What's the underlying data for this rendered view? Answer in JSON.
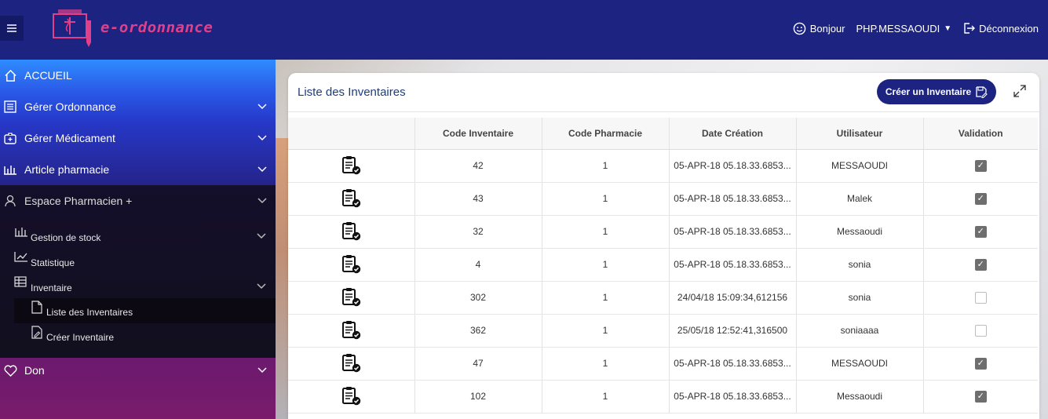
{
  "header": {
    "menu_icon": "hamburger-icon",
    "logo_text": "e-ordonnance",
    "greeting": "Bonjour",
    "user": "PHP.MESSAOUDI",
    "logout": "Déconnexion"
  },
  "sidebar": {
    "items": [
      {
        "label": "ACCUEIL",
        "icon": "home-icon"
      },
      {
        "label": "Gérer Ordonnance",
        "icon": "list-icon"
      },
      {
        "label": "Gérer Médicament",
        "icon": "medkit-icon"
      },
      {
        "label": "Article pharmacie",
        "icon": "bars-icon"
      },
      {
        "label": "Espace Pharmacien +",
        "icon": "user-icon"
      },
      {
        "label": "Don",
        "icon": "heart-icon"
      }
    ],
    "sub_items": [
      {
        "label": "Gestion de stock",
        "icon": "stock-icon"
      },
      {
        "label": "Statistique",
        "icon": "chart-icon"
      },
      {
        "label": "Inventaire",
        "icon": "table-icon"
      }
    ],
    "inventaire_items": [
      {
        "label": "Liste des Inventaires",
        "icon": "file-icon"
      },
      {
        "label": "Créer Inventaire",
        "icon": "file-edit-icon"
      }
    ]
  },
  "card": {
    "title": "Liste des Inventaires",
    "create_button": "Créer un Inventaire"
  },
  "table": {
    "columns": [
      "",
      "Code Inventaire",
      "Code Pharmacie",
      "Date Création",
      "Utilisateur",
      "Validation"
    ],
    "rows": [
      {
        "code": "42",
        "pharmacie": "1",
        "date": "05-APR-18 05.18.33.6853...",
        "user": "MESSAOUDI",
        "validated": true
      },
      {
        "code": "43",
        "pharmacie": "1",
        "date": "05-APR-18 05.18.33.6853...",
        "user": "Malek",
        "validated": true
      },
      {
        "code": "32",
        "pharmacie": "1",
        "date": "05-APR-18 05.18.33.6853...",
        "user": "Messaoudi",
        "validated": true
      },
      {
        "code": "4",
        "pharmacie": "1",
        "date": "05-APR-18 05.18.33.6853...",
        "user": "sonia",
        "validated": true
      },
      {
        "code": "302",
        "pharmacie": "1",
        "date": "24/04/18 15:09:34,612156",
        "user": "sonia",
        "validated": false
      },
      {
        "code": "362",
        "pharmacie": "1",
        "date": "25/05/18 12:52:41,316500",
        "user": "soniaaaa",
        "validated": false
      },
      {
        "code": "47",
        "pharmacie": "1",
        "date": "05-APR-18 05.18.33.6853...",
        "user": "MESSAOUDI",
        "validated": true
      },
      {
        "code": "102",
        "pharmacie": "1",
        "date": "05-APR-18 05.18.33.6853...",
        "user": "Messaoudi",
        "validated": true
      }
    ]
  }
}
